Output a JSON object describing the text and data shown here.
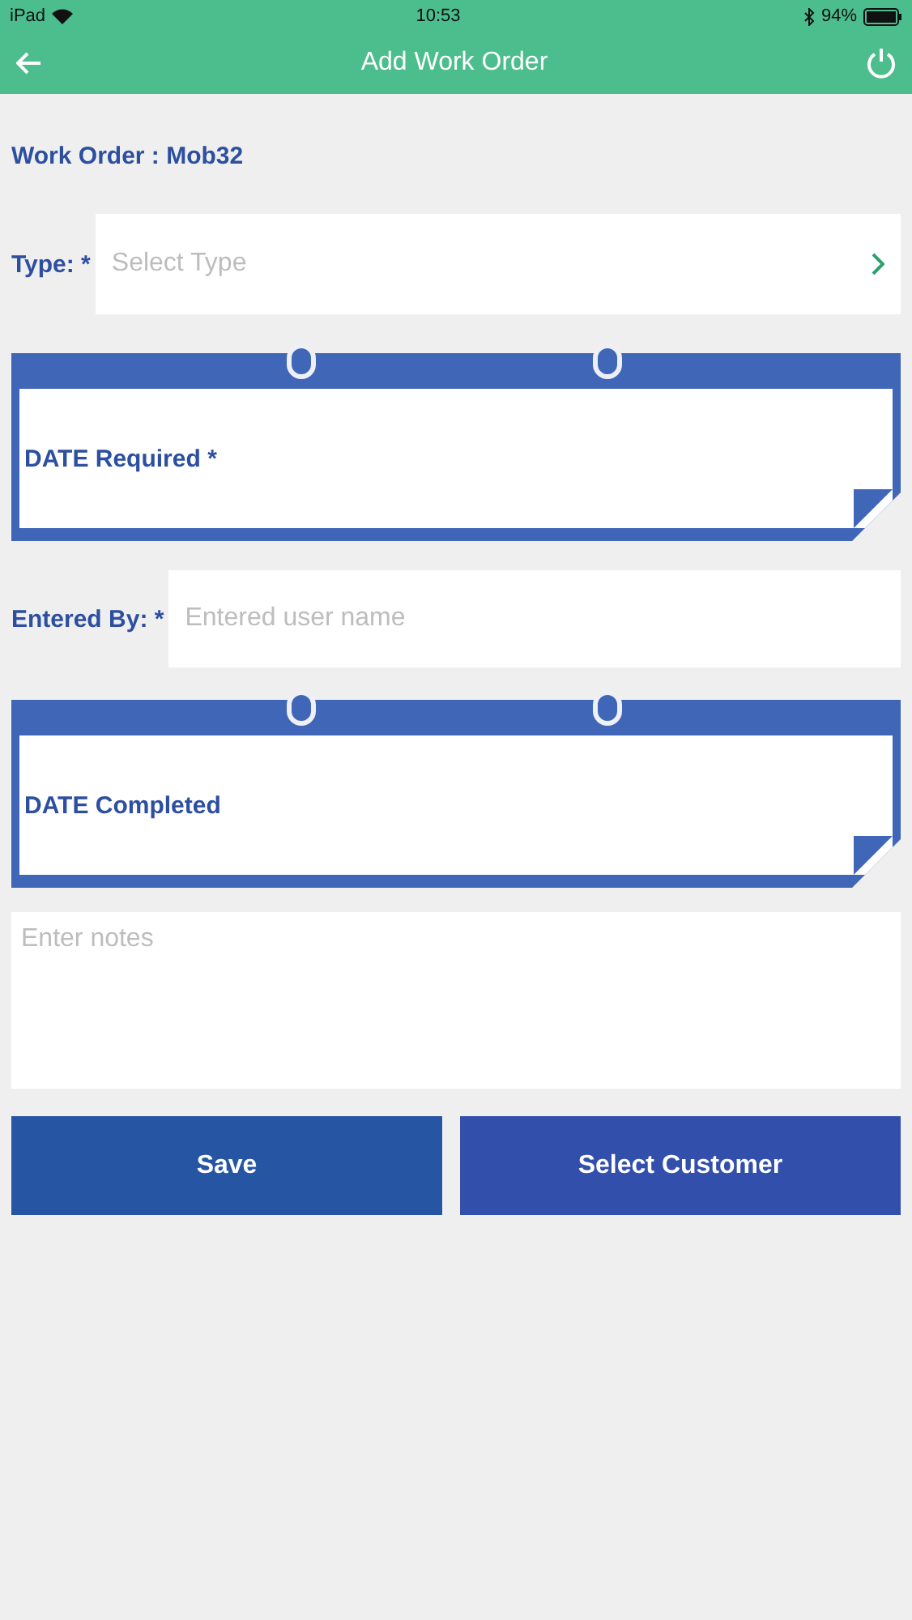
{
  "status_bar": {
    "carrier": "iPad",
    "time": "10:53",
    "battery": "94%"
  },
  "header": {
    "title": "Add Work Order"
  },
  "work_order": "Work Order : Mob32",
  "fields": [
    {
      "kind": "select",
      "label": "Type: *",
      "placeholder": "Select Type"
    },
    {
      "kind": "date",
      "label": "DATE Required *"
    },
    {
      "kind": "text",
      "label": "Entered By: *",
      "placeholder": "Entered user name"
    },
    {
      "kind": "date",
      "label": "DATE Completed"
    },
    {
      "kind": "textarea",
      "placeholder": "Enter notes"
    }
  ],
  "buttons": [
    "Save",
    "Select Customer"
  ]
}
